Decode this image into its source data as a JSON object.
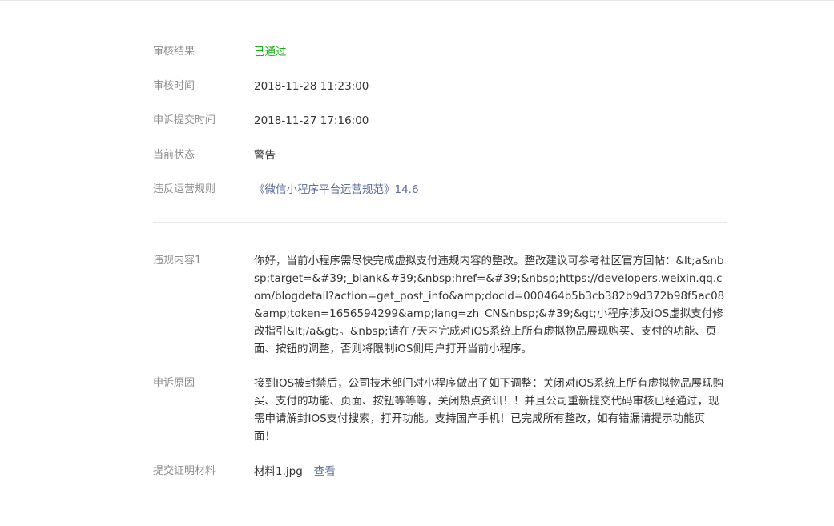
{
  "review": {
    "result_label": "审核结果",
    "result_value": "已通过",
    "time_label": "审核时间",
    "time_value": "2018-11-28 11:23:00",
    "appeal_time_label": "申诉提交时间",
    "appeal_time_value": "2018-11-27 17:16:00",
    "status_label": "当前状态",
    "status_value": "警告",
    "rule_label": "违反运营规则",
    "rule_value": "《微信小程序平台运营规范》14.6"
  },
  "violation": {
    "label": "违规内容1",
    "text": "你好，当前小程序需尽快完成虚拟支付违规内容的整改。整改建议可参考社区官方回帖：&lt;a&nbsp;target=&#39;_blank&#39;&nbsp;href=&#39;&nbsp;https://developers.weixin.qq.com/blogdetail?action=get_post_info&amp;docid=000464b5b3cb382b9d372b98f5ac08&amp;token=1656594299&amp;lang=zh_CN&nbsp;&#39;&gt;小程序涉及iOS虚拟支付修改指引&lt;/a&gt;。&nbsp;请在7天内完成对iOS系统上所有虚拟物品展现购买、支付的功能、页面、按钮的调整，否则将限制iOS侧用户打开当前小程序。"
  },
  "appeal": {
    "label": "申诉原因",
    "text": "接到IOS被封禁后，公司技术部门对小程序做出了如下调整：关闭对iOS系统上所有虚拟物品展现购买、支付的功能、页面、按钮等等等，关闭热点资讯！！并且公司重新提交代码审核已经通过，现需申请解封IOS支付搜索，打开功能。支持国产手机！已完成所有整改，如有错漏请提示功能页面！"
  },
  "evidence": {
    "label": "提交证明材料",
    "file_name": "材料1.jpg",
    "view_label": "查看"
  },
  "colors": {
    "passed": "#1aad19",
    "link": "#576b95",
    "label": "#8d8d8d",
    "text": "#353535",
    "divider": "#e7e7eb"
  }
}
